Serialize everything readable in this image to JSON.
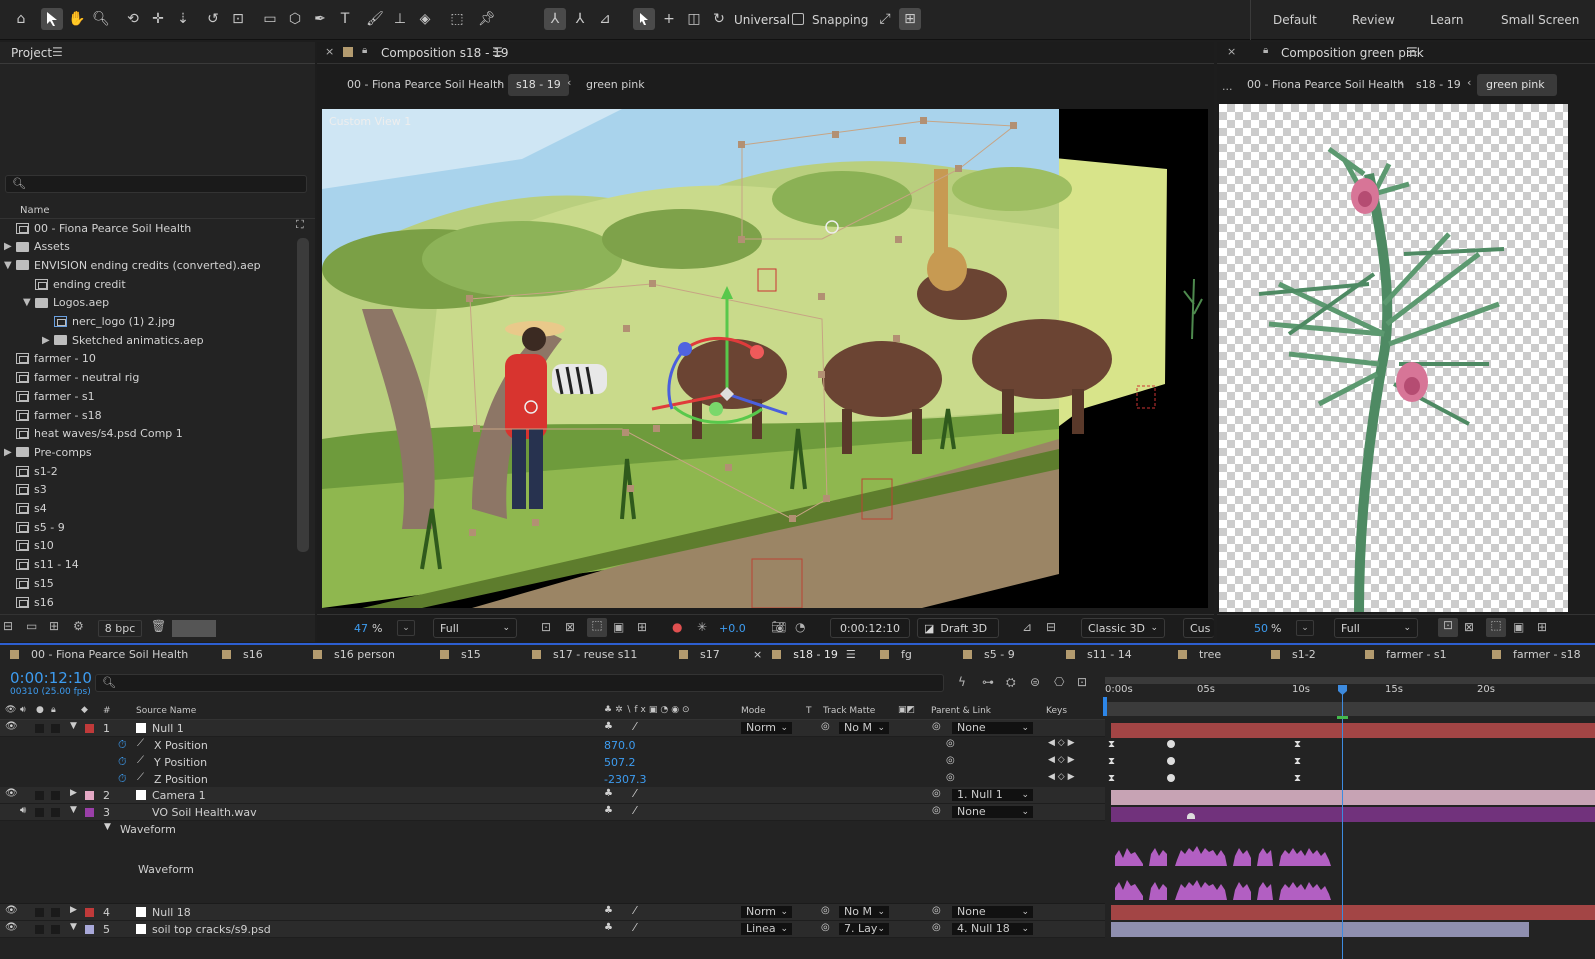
{
  "toolbar": {
    "tools": [
      "home-icon",
      "selection-arrow-icon",
      "hand-icon",
      "zoom-icon",
      "orbit-camera-icon",
      "pan-camera-icon",
      "dolly-camera-icon",
      "rotate-icon",
      "anchor-point-icon",
      "rectangle-icon",
      "cube-icon",
      "pen-icon",
      "type-icon",
      "brush-icon",
      "clone-stamp-icon",
      "eraser-icon",
      "roto-brush-icon",
      "puppet-pin-icon"
    ],
    "axis_mode_label": "Universal",
    "snapping_label": "Snapping",
    "workspaces": [
      "Default",
      "Review",
      "Learn",
      "Small Screen"
    ]
  },
  "project": {
    "title": "Project",
    "search_placeholder": "",
    "column_name": "Name",
    "items": [
      {
        "label": "00 - Fiona Pearce Soil Health",
        "type": "comp",
        "indent": 0,
        "arrow": ""
      },
      {
        "label": "Assets",
        "type": "folder",
        "indent": 0,
        "arrow": "▶"
      },
      {
        "label": "ENVISION ending credits (converted).aep",
        "type": "folder",
        "indent": 0,
        "arrow": "▼"
      },
      {
        "label": "ending credit",
        "type": "comp",
        "indent": 1,
        "arrow": ""
      },
      {
        "label": "Logos.aep",
        "type": "folder",
        "indent": 1,
        "arrow": "▼"
      },
      {
        "label": "nerc_logo (1) 2.jpg",
        "type": "file",
        "indent": 2,
        "arrow": ""
      },
      {
        "label": "Sketched animatics.aep",
        "type": "folder",
        "indent": 2,
        "arrow": "▶"
      },
      {
        "label": "farmer - 10",
        "type": "comp",
        "indent": 0,
        "arrow": ""
      },
      {
        "label": "farmer - neutral rig",
        "type": "comp",
        "indent": 0,
        "arrow": ""
      },
      {
        "label": "farmer - s1",
        "type": "comp",
        "indent": 0,
        "arrow": ""
      },
      {
        "label": "farmer - s18",
        "type": "comp",
        "indent": 0,
        "arrow": ""
      },
      {
        "label": "heat waves/s4.psd Comp 1",
        "type": "comp",
        "indent": 0,
        "arrow": ""
      },
      {
        "label": "Pre-comps",
        "type": "folder",
        "indent": 0,
        "arrow": "▶"
      },
      {
        "label": "s1-2",
        "type": "comp",
        "indent": 0,
        "arrow": ""
      },
      {
        "label": "s3",
        "type": "comp",
        "indent": 0,
        "arrow": ""
      },
      {
        "label": "s4",
        "type": "comp",
        "indent": 0,
        "arrow": ""
      },
      {
        "label": "s5 - 9",
        "type": "comp",
        "indent": 0,
        "arrow": ""
      },
      {
        "label": "s10",
        "type": "comp",
        "indent": 0,
        "arrow": ""
      },
      {
        "label": "s11 - 14",
        "type": "comp",
        "indent": 0,
        "arrow": ""
      },
      {
        "label": "s15",
        "type": "comp",
        "indent": 0,
        "arrow": ""
      },
      {
        "label": "s16",
        "type": "comp",
        "indent": 0,
        "arrow": ""
      }
    ],
    "bpc": "8 bpc"
  },
  "comp_main": {
    "title": "Composition s18 - 19",
    "breadcrumb": [
      "00 - Fiona Pearce Soil Health",
      "s18 - 19",
      "green pink"
    ],
    "view_label": "Custom View 1",
    "zoom": "47",
    "zoom_unit": "%",
    "resolution": "Full",
    "exposure": "+0.0",
    "timecode": "0:00:12:10",
    "draft": "Draft 3D",
    "renderer": "Classic 3D",
    "extra": "Cus"
  },
  "comp_side": {
    "title": "Composition green pink",
    "breadcrumb_more": "...",
    "breadcrumb": [
      "00 - Fiona Pearce Soil Health",
      "s18 - 19",
      "green pink"
    ],
    "zoom": "50",
    "zoom_unit": "%",
    "resolution": "Full"
  },
  "timeline": {
    "tabs": [
      "00 - Fiona Pearce Soil Health",
      "s16",
      "s16 person",
      "s15",
      "s17 - reuse s11",
      "s17",
      "s18 - 19",
      "fg",
      "s5 - 9",
      "s11 - 14",
      "tree",
      "s1-2",
      "farmer - s1",
      "farmer - s18"
    ],
    "active_tab": "s18 - 19",
    "timecode": "0:00:12:10",
    "frame_info": "00310 (25.00 fps)",
    "search_placeholder": "",
    "headers": {
      "hash": "#",
      "source": "Source Name",
      "mode": "Mode",
      "t": "T",
      "matte": "Track Matte",
      "parent": "Parent & Link",
      "keys": "Keys"
    },
    "ruler": [
      "0:00s",
      "05s",
      "10s",
      "15s",
      "20s"
    ],
    "layers": [
      {
        "num": "1",
        "name": "Null 1",
        "color": "#c03a3a",
        "mode": "Norm",
        "matte": "No M",
        "parent": "None"
      },
      {
        "num": "2",
        "name": "Camera 1",
        "color": "#e4a8c4",
        "mode": "",
        "matte": "",
        "parent": "1. Null 1"
      },
      {
        "num": "3",
        "name": "VO Soil Health.wav",
        "color": "#9a3fa8",
        "mode": "",
        "matte": "",
        "parent": "None"
      },
      {
        "num": "4",
        "name": "Null 18",
        "color": "#c03a3a",
        "mode": "Norm",
        "matte": "No M",
        "parent": "None"
      },
      {
        "num": "5",
        "name": "soil top cracks/s9.psd",
        "color": "#a8a8d8",
        "mode": "Linea",
        "matte": "7. Lay",
        "parent": "4. Null 18"
      }
    ],
    "props": [
      {
        "name": "X Position",
        "value": "870.0"
      },
      {
        "name": "Y Position",
        "value": "507.2"
      },
      {
        "name": "Z Position",
        "value": "-2307.3"
      }
    ],
    "waveform_group": "Waveform",
    "waveform_label": "Waveform"
  }
}
